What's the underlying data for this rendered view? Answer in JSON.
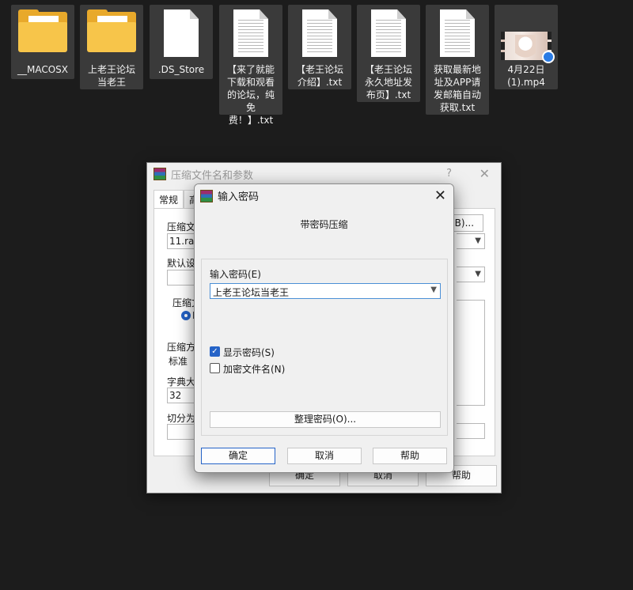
{
  "desktop": {
    "files": [
      {
        "name": "__MACOSX",
        "type": "folder"
      },
      {
        "name": "上老王论坛当老王",
        "type": "folder"
      },
      {
        "name": ".DS_Store",
        "type": "file"
      },
      {
        "name": "【来了就能下载和观看的论坛，纯免费！】.txt",
        "type": "text"
      },
      {
        "name": "【老王论坛介绍】.txt",
        "type": "text"
      },
      {
        "name": "【老王论坛永久地址发布页】.txt",
        "type": "text"
      },
      {
        "name": "获取最新地址及APP请发邮箱自动获取.txt",
        "type": "text"
      },
      {
        "name": "4月22日 (1).mp4",
        "type": "video"
      }
    ]
  },
  "back_dialog": {
    "title": "压缩文件名和参数",
    "help_symbol": "?",
    "close_symbol": "✕",
    "tabs": [
      "常规",
      "高"
    ],
    "archive_name_label": "压缩文件",
    "archive_name_value": "11.rar",
    "browse_label": "(B)...",
    "default_settings_label": "默认设置",
    "format_label": "压缩文",
    "format_option": "R",
    "method_label": "压缩方式",
    "method_value": "标准",
    "dict_label": "字典大小",
    "dict_value": "32",
    "split_label": "切分为分",
    "ok": "确定",
    "cancel": "取消",
    "help": "帮助"
  },
  "front_dialog": {
    "title": "输入密码",
    "close_symbol": "✕",
    "subtitle": "带密码压缩",
    "password_label": "输入密码(E)",
    "password_value": "上老王论坛当老王",
    "show_password_label": "显示密码(S)",
    "show_password_checked": true,
    "encrypt_names_label": "加密文件名(N)",
    "encrypt_names_checked": false,
    "organize_label": "整理密码(O)...",
    "ok": "确定",
    "cancel": "取消",
    "help": "帮助"
  }
}
